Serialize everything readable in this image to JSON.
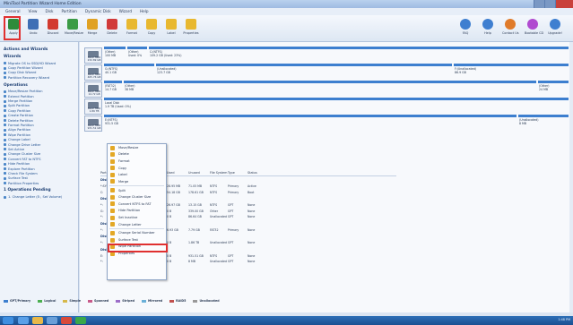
{
  "window": {
    "title": "MiniTool Partition Wizard Home Edition"
  },
  "menu": [
    "General",
    "View",
    "Disk",
    "Partition",
    "Dynamic Disk",
    "Wizard",
    "Help"
  ],
  "toolbar": [
    {
      "label": "Apply",
      "icon": "checkmark-icon",
      "color": "#2e8b3a"
    },
    {
      "label": "Undo",
      "icon": "undo-icon",
      "color": "#3f6fb5"
    },
    {
      "label": "Discard",
      "icon": "discard-icon",
      "color": "#d23a2f"
    },
    {
      "label": "Move/Resize",
      "icon": "resize-icon",
      "color": "#3b9b46"
    },
    {
      "label": "Merge",
      "icon": "merge-icon",
      "color": "#e0a123"
    },
    {
      "label": "Delete",
      "icon": "delete-icon",
      "color": "#d13a3a"
    },
    {
      "label": "Format",
      "icon": "format-icon",
      "color": "#e8b830"
    },
    {
      "label": "Copy",
      "icon": "copy-icon",
      "color": "#e8b830"
    },
    {
      "label": "Label",
      "icon": "label-icon",
      "color": "#e8b830"
    },
    {
      "label": "Properties",
      "icon": "properties-icon",
      "color": "#e8b830"
    }
  ],
  "toolbar_right": [
    {
      "label": "FAQ",
      "icon": "faq-icon",
      "color": "#3f7fd0"
    },
    {
      "label": "Help",
      "icon": "help-icon",
      "color": "#3f7fd0"
    },
    {
      "label": "Contact Us",
      "icon": "contact-icon",
      "color": "#e07b2a"
    },
    {
      "label": "Bootable CD",
      "icon": "cd-icon",
      "color": "#b04ad0"
    },
    {
      "label": "Upgrade!",
      "icon": "upgrade-icon",
      "color": "#3f7fd0"
    }
  ],
  "sidebar": {
    "section1": "Actions and Wizards",
    "wizards_head": "Wizards",
    "wizards": [
      "Migrate OS to SSD/HD Wizard",
      "Copy Partition Wizard",
      "Copy Disk Wizard",
      "Partition Recovery Wizard"
    ],
    "operations_head": "Operations",
    "operations": [
      "Move/Resize Partition",
      "Extend Partition",
      "Merge Partition",
      "Split Partition",
      "Copy Partition",
      "Create Partition",
      "Delete Partition",
      "Format Partition",
      "Align Partition",
      "Wipe Partition",
      "Change Label",
      "Change Drive Letter",
      "Set Active",
      "Change Cluster Size",
      "Convert FAT to NTFS",
      "Hide Partition",
      "Explore Partition",
      "Check File System",
      "Surface Test",
      "Partition Properties"
    ],
    "pending_head": "1 Operations Pending",
    "pending": [
      "1. Change Letter (E:, Set Volume)"
    ]
  },
  "disks": [
    {
      "name": "Basic MBR",
      "size": "232.89 GB",
      "parts": [
        {
          "label": "(Other)",
          "info": "100 MB"
        },
        {
          "label": "(Other)",
          "info": "Used: 0%"
        },
        {
          "label": "C:(NTFS)",
          "info": "109.2 GB (Used: 23%)"
        }
      ]
    },
    {
      "name": "Basic MBR",
      "size": "465.76 GB",
      "parts": [
        {
          "label": "G:(NTFS)",
          "info": "40.1 GB"
        },
        {
          "label": "(Unallocated)",
          "info": "123.7 GB"
        },
        {
          "label": "F:(Unallocated)",
          "info": "86.9 GB"
        }
      ]
    },
    {
      "name": "Basic MBR",
      "size": "14.72 GB",
      "parts": [
        {
          "label": "(FAT32)",
          "info": "14.7 GB"
        },
        {
          "label": "(Other)",
          "info": "38 MB"
        },
        {
          "label": "(Other)",
          "info": "24 MB"
        }
      ]
    },
    {
      "name": "Basic MBR",
      "size": "1.86 TB",
      "parts": [
        {
          "label": "Local Disk",
          "info": "1.9 TB (Used: 0%)"
        }
      ]
    },
    {
      "name": "Basic MBR",
      "size": "931.51 GB",
      "parts": [
        {
          "label": "E:(NTFS)",
          "info": "931.5 GB"
        },
        {
          "label": "(Unallocated)",
          "info": "8 MB"
        }
      ]
    }
  ],
  "table": {
    "headers": [
      "Partition",
      "Capacity",
      "Used",
      "Unused",
      "File System",
      "Type",
      "Status"
    ],
    "sections": [
      {
        "title": "Disk 1",
        "rows": [
          [
            "*:SYSTEM",
            "100.00 MB",
            "28.95 MB",
            "71.05 MB",
            "NTFS",
            "Primary",
            "Active"
          ],
          [
            "C:",
            "232.79 GB",
            "54.18 GB",
            "178.61 GB",
            "NTFS",
            "Primary",
            "Boot"
          ]
        ]
      },
      {
        "title": "Disk 2",
        "rows": [
          [
            "*:",
            "40.12 GB",
            "26.97 GB",
            "13.15 GB",
            "NTFS",
            "GPT",
            "None"
          ],
          [
            "G:",
            "339.00 GB",
            "0 B",
            "339.00 GB",
            "Other",
            "GPT",
            "None"
          ],
          [
            "*:",
            "86.64 GB",
            "0 B",
            "86.64 GB",
            "Unallocated",
            "GPT",
            "None"
          ]
        ]
      },
      {
        "title": "Disk 3",
        "rows": [
          [
            "*:",
            "14.72 GB",
            "6.93 GB",
            "7.79 GB",
            "FAT32",
            "Primary",
            "None"
          ]
        ]
      },
      {
        "title": "Disk 4",
        "rows": [
          [
            "*:",
            "1.86 TB",
            "0 B",
            "1.86 TB",
            "Unallocated",
            "GPT",
            "None"
          ]
        ]
      },
      {
        "title": "Disk 5",
        "rows": [
          [
            "E:",
            "931.51 GB",
            "0 B",
            "931.51 GB",
            "NTFS",
            "GPT",
            "None"
          ],
          [
            "*:",
            "8 MB",
            "0 B",
            "8 MB",
            "Unallocated",
            "GPT",
            "None"
          ]
        ]
      }
    ]
  },
  "context_menu": [
    "Move/Resize",
    "Delete",
    "Format",
    "Copy",
    "Label",
    "Merge",
    "Split",
    "Change Cluster Size",
    "Convert NTFS to FAT",
    "Hide Partition",
    "Set Inactive",
    "Change Letter",
    "Change Serial Number",
    "Surface Test",
    "Wipe Partition",
    "Properties"
  ],
  "legend": [
    "GPT/Primary",
    "Logical",
    "Simple",
    "Spanned",
    "Striped",
    "Mirrored",
    "RAID5",
    "Unallocated"
  ],
  "legend_colors": [
    "#3d7fcf",
    "#4caf50",
    "#d6b84a",
    "#c85b8a",
    "#9c6dc8",
    "#6ab0d8",
    "#c0504d",
    "#999999"
  ],
  "tray": {
    "clock": "1:48 PM"
  }
}
